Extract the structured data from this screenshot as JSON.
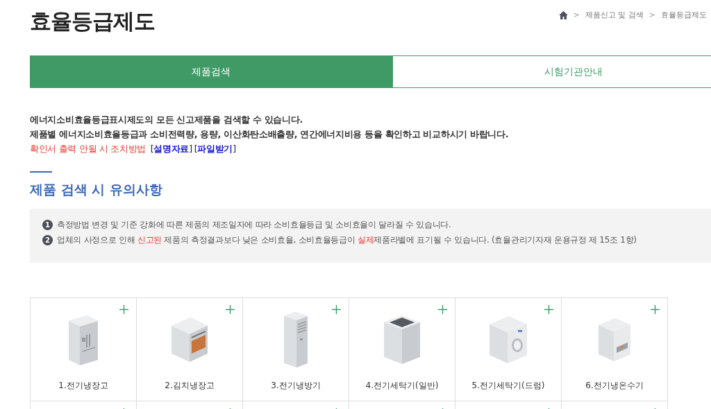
{
  "page_title": "효율등급제도",
  "breadcrumb": [
    {
      "separator": ">",
      "label": "제품신고 및 검색"
    },
    {
      "separator": ">",
      "label": "효율등급제도"
    }
  ],
  "tabs": [
    {
      "label": "제품검색",
      "selected": true
    },
    {
      "label": "시험기관안내",
      "selected": false
    }
  ],
  "intro": [
    "에너지소비효율등급표시제도의 모든 신고제품을 검색할 수 있습니다.",
    "제품별 에너지소비효율등급과 소비전력량, 용량, 이산화탄소배출량, 연간에너지비용 등을 확인하고 비교하시기 바랍니다."
  ],
  "help": {
    "text": "확인서 출력 안될 시 조치방법",
    "links": [
      "[**설명자료**]",
      "[**파일받기**]"
    ]
  },
  "notice_title": "제품 검색 시 유의사항",
  "notices": [
    {
      "number": "1",
      "segments": [
        {
          "text": "측정방법 변경 및 기준 강화에 따른 제품의 제조일자에 따라 소비효율등급 및 소비효율이 달라질 수 있습니다.",
          "highlight": false
        }
      ]
    },
    {
      "number": "2",
      "segments": [
        {
          "text": "업체의 사정으로 인해 ",
          "highlight": false
        },
        {
          "text": "신고된",
          "highlight": true
        },
        {
          "text": " 제품의 측정결과보다 낮은 소비효율, 소비효율등급이 ",
          "highlight": false
        },
        {
          "text": "실제",
          "highlight": true
        },
        {
          "text": "제품라벨에 표기될 수 있습니다. (효율관리기자재 운용규정 제 15조 1항)",
          "highlight": false
        }
      ]
    }
  ],
  "products": [
    {
      "kind": "fridge",
      "label": "1.전기냉장고"
    },
    {
      "kind": "kimchi",
      "label": "2.김치냉장고"
    },
    {
      "kind": "aircon",
      "label": "3.전기냉방기"
    },
    {
      "kind": "topwasher",
      "label": "4.전기세탁기(일반)"
    },
    {
      "kind": "drumwasher",
      "label": "5.전기세탁기(드럼)"
    },
    {
      "kind": "dispenser",
      "label": "6.전기냉온수기"
    }
  ]
}
